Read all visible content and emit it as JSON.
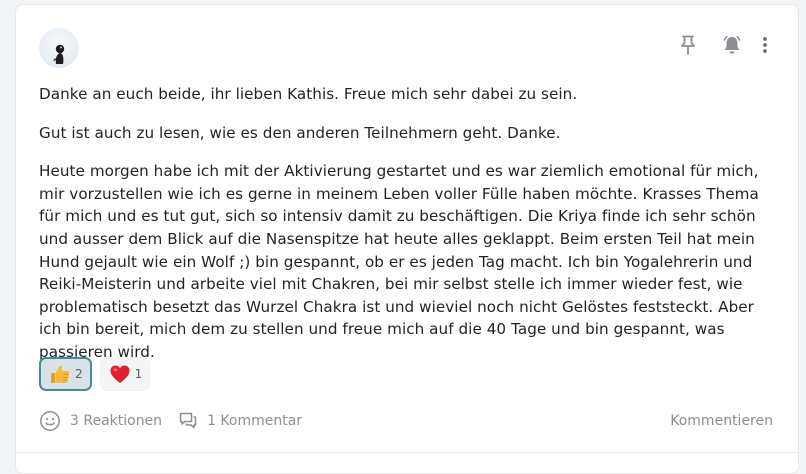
{
  "post": {
    "paragraphs": [
      "Danke an euch beide, ihr lieben Kathis. Freue mich sehr dabei zu sein.",
      "Gut ist auch zu lesen, wie es den anderen Teilnehmern geht. Danke.",
      "Heute morgen habe ich mit der Aktivierung gestartet und es war ziemlich emotional für mich, mir vorzustellen wie ich es gerne in meinem Leben voller Fülle haben möchte. Krasses Thema für mich und es tut gut, sich so intensiv damit zu beschäftigen. Die Kriya finde ich sehr schön und ausser dem Blick auf die Nasenspitze hat heute alles geklappt. Beim ersten Teil hat mein Hund gejault wie ein Wolf ;) bin gespannt, ob er es jeden Tag macht. Ich bin Yogalehrerin und Reiki-Meisterin und arbeite viel mit Chakren, bei mir selbst stelle ich immer wieder fest, wie problematisch besetzt das Wurzel Chakra ist und wieviel noch nicht Gelöstes feststeckt. Aber ich bin bereit, mich dem zu stellen und freue mich auf die 40 Tage und bin gespannt, was passieren wird."
    ]
  },
  "reactions": [
    {
      "emoji": "thumbs-up-icon",
      "count": "2",
      "active": true
    },
    {
      "emoji": "heart-icon",
      "count": "1",
      "active": false
    }
  ],
  "footer": {
    "reactions_label": "3 Reaktionen",
    "comments_label": "1 Kommentar",
    "comment_action": "Kommentieren"
  },
  "colors": {
    "active_chip_border": "#4a8a96",
    "active_chip_bg": "#d9e2e9",
    "muted_text": "#8a8f95",
    "heart": "#e0202f",
    "thumb": "#f6b93b"
  }
}
